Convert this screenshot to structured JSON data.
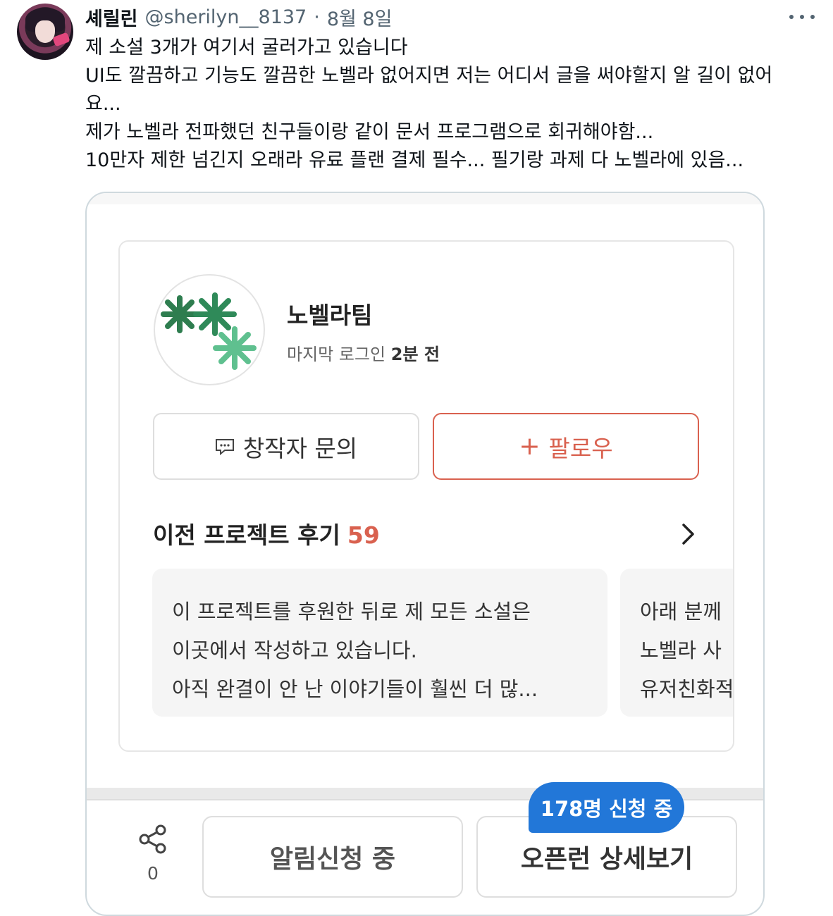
{
  "tweet": {
    "author_name": "셰릴린",
    "handle": "@sherilyn__8137",
    "separator": "·",
    "date": "8월 8일",
    "lines": [
      "제 소설 3개가 여기서 굴러가고 있습니다",
      "UI도 깔끔하고 기능도 깔끔한 노벨라 없어지면 저는 어디서 글을 써야할지 알 길이 없어",
      "요...",
      "제가 노벨라 전파했던 친구들이랑 같이 문서 프로그램으로 회귀해야함...",
      "10만자 제한 넘긴지 오래라 유료 플랜 결제 필수... 필기랑 과제 다 노벨라에 있음..."
    ]
  },
  "screenshot": {
    "creator": {
      "name": "노벨라팀",
      "last_login_label": "마지막 로그인",
      "last_login_value": "2분 전"
    },
    "buttons": {
      "inquiry": "창작자 문의",
      "follow_plus": "+",
      "follow": "팔로우"
    },
    "reviews": {
      "title": "이전 프로젝트 후기",
      "count": "59",
      "items": [
        {
          "line1": "이 프로젝트를 후원한 뒤로 제 모든 소설은",
          "line2": "이곳에서 작성하고 있습니다.",
          "line3": "아직 완결이 안 난 이야기들이 훨씬 더 많..."
        },
        {
          "line1": "아래 분께",
          "line2": "노벨라 사",
          "line3": "유저친화적"
        }
      ]
    },
    "share_count": "0",
    "badge": "178명 신청 중",
    "alarm_button": "알림신청 중",
    "openrun_button": "오픈런 상세보기"
  },
  "colors": {
    "accent": "#d9614f",
    "badge": "#2277d8",
    "logo_dark": "#2e7d4f",
    "logo_light": "#5fc08f"
  }
}
